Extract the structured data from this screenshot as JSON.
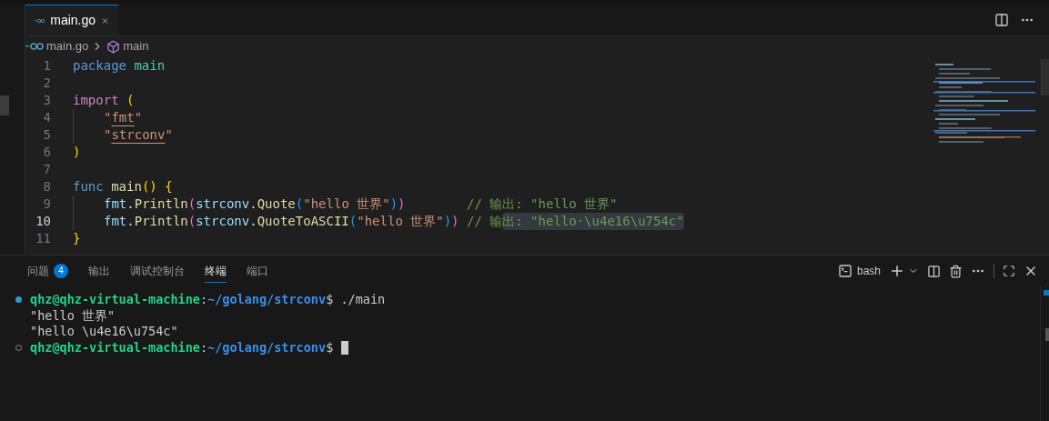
{
  "editor_tabs": [
    {
      "label": "main.go",
      "selected": true
    }
  ],
  "breadcrumbs": [
    "main.go",
    "main"
  ],
  "code": {
    "lines": [
      {
        "number": "1",
        "active": false,
        "indent": false,
        "tokens": [
          {
            "kind": "keyword",
            "text": "package"
          },
          {
            "kind": "type",
            "text": " main"
          }
        ]
      },
      {
        "number": "2",
        "active": false,
        "indent": false
      },
      {
        "number": "3",
        "active": false,
        "indent": false,
        "tokens": [
          {
            "kind": "control",
            "text": "import"
          },
          {
            "kind": "paren1",
            "text": " ("
          }
        ]
      },
      {
        "number": "4",
        "active": false,
        "indent": true,
        "tokens": [
          {
            "kind": "string",
            "text": "\""
          },
          {
            "kind": "link",
            "text": "fmt"
          },
          {
            "kind": "string",
            "text": "\""
          }
        ]
      },
      {
        "number": "5",
        "active": false,
        "indent": true,
        "tokens": [
          {
            "kind": "string",
            "text": "\""
          },
          {
            "kind": "link",
            "text": "strconv"
          },
          {
            "kind": "string",
            "text": "\""
          }
        ]
      },
      {
        "number": "6",
        "active": false,
        "indent": false,
        "tokens": [
          {
            "kind": "paren1",
            "text": ")"
          }
        ]
      },
      {
        "number": "7",
        "active": false,
        "indent": false
      },
      {
        "number": "8",
        "active": false,
        "indent": false,
        "tokens": [
          {
            "kind": "keyword",
            "text": "func"
          },
          {
            "kind": "function",
            "text": " main"
          },
          {
            "kind": "paren1",
            "text": "() {"
          }
        ]
      },
      {
        "number": "9",
        "active": false,
        "indent": true,
        "tokens": [
          {
            "kind": "variable",
            "text": "fmt"
          },
          {
            "kind": "plain",
            "text": "."
          },
          {
            "kind": "function",
            "text": "Println"
          },
          {
            "kind": "paren2",
            "text": "("
          },
          {
            "kind": "variable",
            "text": "strconv"
          },
          {
            "kind": "plain",
            "text": "."
          },
          {
            "kind": "function",
            "text": "Quote"
          },
          {
            "kind": "paren3",
            "text": "("
          },
          {
            "kind": "string",
            "text": "\"hello 世界\""
          },
          {
            "kind": "paren3",
            "text": ")"
          },
          {
            "kind": "paren2",
            "text": ")"
          },
          {
            "kind": "comment",
            "text": "        // 输出: \"hello 世界\""
          }
        ]
      },
      {
        "number": "10",
        "active": true,
        "indent": true,
        "tokens": [
          {
            "kind": "variable",
            "text": "fmt"
          },
          {
            "kind": "plain",
            "text": "."
          },
          {
            "kind": "function",
            "text": "Println"
          },
          {
            "kind": "paren2",
            "text": "("
          },
          {
            "kind": "variable",
            "text": "strconv"
          },
          {
            "kind": "plain",
            "text": "."
          },
          {
            "kind": "function",
            "text": "QuoteToASCII"
          },
          {
            "kind": "paren3",
            "text": "("
          },
          {
            "kind": "string",
            "text": "\"hello 世界\""
          },
          {
            "kind": "paren3",
            "text": ")"
          },
          {
            "kind": "paren2",
            "text": ")"
          },
          {
            "kind": "comment",
            "text": " // 输"
          },
          {
            "kind": "highlight",
            "text": "出: \"hello·\\u4e16\\u754c\""
          }
        ]
      },
      {
        "number": "11",
        "active": false,
        "indent": false,
        "tokens": [
          {
            "kind": "paren1",
            "text": "}"
          }
        ]
      }
    ]
  },
  "panel": {
    "tabs": [
      {
        "label": "问题",
        "badge": "4",
        "selected": false
      },
      {
        "label": "输出",
        "selected": false
      },
      {
        "label": "调试控制台",
        "selected": false
      },
      {
        "label": "终端",
        "selected": true
      },
      {
        "label": "端口",
        "selected": false
      }
    ],
    "terminal_name": "bash"
  },
  "terminal": {
    "lines": [
      {
        "kind": "prompt",
        "succeeded": true,
        "user": "qhz@qhz-virtual-machine",
        "sep": ":",
        "path": "~/golang/strconv",
        "dollar": "$",
        "command": " ./main"
      },
      {
        "kind": "output",
        "text": "\"hello 世界\""
      },
      {
        "kind": "output",
        "text": "\"hello \\u4e16\\u754c\""
      },
      {
        "kind": "prompt",
        "succeeded": false,
        "user": "qhz@qhz-virtual-machine",
        "sep": ":",
        "path": "~/golang/strconv",
        "dollar": "$",
        "cursor": true
      }
    ]
  }
}
